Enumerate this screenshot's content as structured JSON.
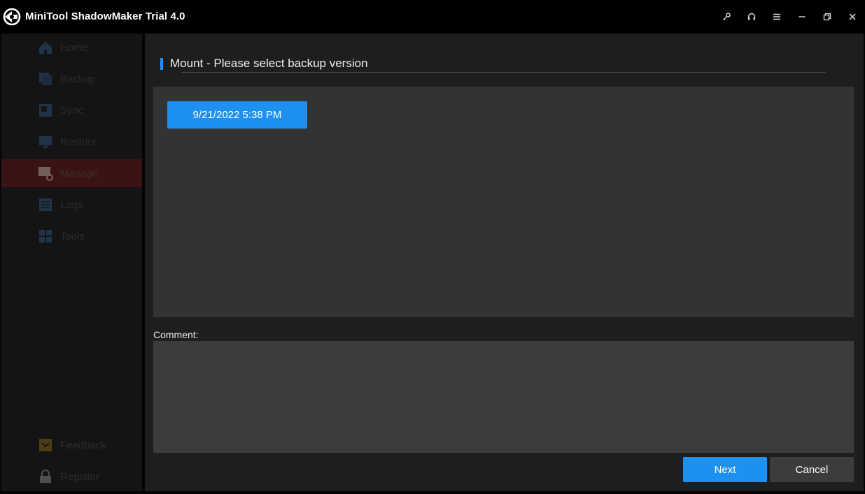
{
  "app": {
    "title": "MiniTool ShadowMaker Trial 4.0",
    "logo_icon": "minitool-logo-icon"
  },
  "window_controls": [
    {
      "name": "key-icon",
      "action": "register"
    },
    {
      "name": "headset-icon",
      "action": "support"
    },
    {
      "name": "menu-icon",
      "action": "menu"
    },
    {
      "name": "minimize-icon",
      "action": "minimize"
    },
    {
      "name": "restore-icon",
      "action": "restore"
    },
    {
      "name": "close-icon",
      "action": "close"
    }
  ],
  "sidebar": {
    "items": [
      {
        "label": "Home",
        "icon": "home-icon",
        "active": false
      },
      {
        "label": "Backup",
        "icon": "backup-icon",
        "active": false
      },
      {
        "label": "Sync",
        "icon": "sync-icon",
        "active": false
      },
      {
        "label": "Restore",
        "icon": "restore-icon",
        "active": false
      },
      {
        "label": "Manage",
        "icon": "manage-icon",
        "active": true
      },
      {
        "label": "Logs",
        "icon": "logs-icon",
        "active": false
      },
      {
        "label": "Tools",
        "icon": "tools-icon",
        "active": false
      }
    ],
    "bottom_items": [
      {
        "label": "Feedback",
        "icon": "feedback-icon"
      },
      {
        "label": "Register",
        "icon": "lock-icon"
      }
    ]
  },
  "dialog": {
    "heading": "Mount - Please select backup version",
    "versions": [
      "9/21/2022 5:38 PM"
    ],
    "comment_label": "Comment:",
    "comment_value": "",
    "next_label": "Next",
    "cancel_label": "Cancel"
  },
  "colors": {
    "accent": "#1e90f0",
    "titlebar": "#000000",
    "panel": "#333333",
    "comment_box": "#3c3c3c"
  }
}
